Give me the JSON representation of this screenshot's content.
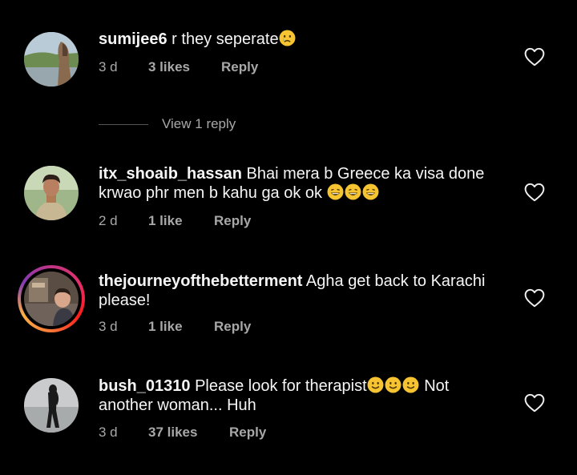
{
  "colors": {
    "background": "#000000",
    "text": "#f5f5f5",
    "secondary": "#a8a8a8",
    "emoji": "#f6c430"
  },
  "comments": [
    {
      "username": "sumijee6",
      "text": " r they seperate",
      "emoji": [
        "crying-face"
      ],
      "text_after": "",
      "time": "3 d",
      "likes": "3 likes",
      "reply": "Reply"
    },
    {
      "username": "itx_shoaib_hassan",
      "text": " Bhai mera b Greece ka visa done krwao phr men b kahu ga ok ok ",
      "emoji": [
        "grinning-sweat-face",
        "grinning-sweat-face",
        "grinning-sweat-face"
      ],
      "text_after": "",
      "time": "2 d",
      "likes": "1 like",
      "reply": "Reply"
    },
    {
      "username": "thejourneyofthebetterment",
      "text": " Agha get back to Karachi please!",
      "emoji": [],
      "text_after": "",
      "time": "3 d",
      "likes": "1 like",
      "reply": "Reply"
    },
    {
      "username": "bush_01310",
      "text": " Please look for therapist",
      "emoji": [
        "smiling-face",
        "smiling-face",
        "smiling-face"
      ],
      "text_after": " Not another woman... Huh",
      "time": "3 d",
      "likes": "37 likes",
      "reply": "Reply"
    }
  ],
  "view_replies": "View 1 reply"
}
